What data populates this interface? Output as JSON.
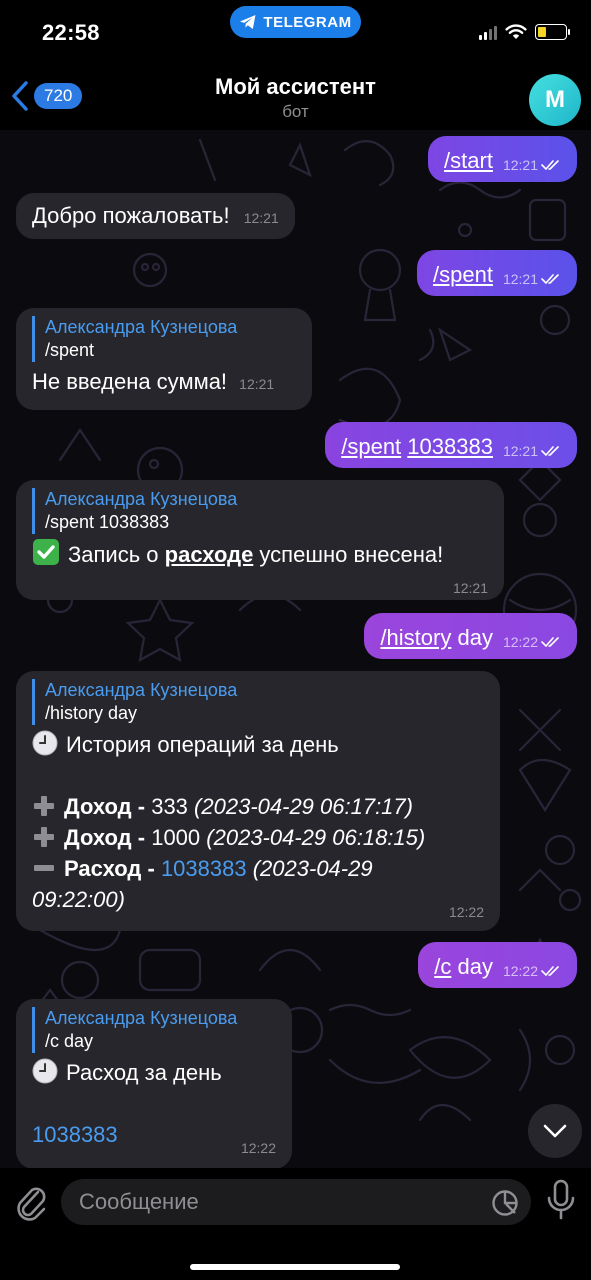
{
  "status_bar": {
    "time": "22:58",
    "app_pill": "TELEGRAM"
  },
  "nav": {
    "back_count": "720",
    "title": "Мой ассистент",
    "subtitle": "бот",
    "avatar_letter": "M"
  },
  "colors": {
    "outgoing_bubble": "#7e46e4",
    "incoming_bubble": "#26262c",
    "accent_blue": "#4a9cf0",
    "avatar": "#2fc9d4"
  },
  "messages": [
    {
      "dir": "out",
      "text": "/start",
      "time": "12:21",
      "read": true
    },
    {
      "dir": "in",
      "text": "Добро пожаловать!",
      "time": "12:21"
    },
    {
      "dir": "out",
      "text": "/spent",
      "time": "12:21",
      "read": true
    },
    {
      "dir": "in",
      "reply_author": "Александра Кузнецова",
      "reply_text": "/spent",
      "text": "Не введена сумма!",
      "time": "12:21"
    },
    {
      "dir": "out",
      "cmd": "/spent",
      "arg": "1038383",
      "time": "12:21",
      "read": true
    },
    {
      "dir": "in",
      "reply_author": "Александра Кузнецова",
      "reply_text": "/spent 1038383",
      "icon": "check-mark-icon",
      "pre": "Запись о ",
      "bold": "расходе",
      "post": " успешно внесена!",
      "time": "12:21"
    },
    {
      "dir": "out",
      "cmd": "/history",
      "arg": "day",
      "time": "12:22",
      "read": true
    },
    {
      "dir": "in",
      "reply_author": "Александра Кузнецова",
      "reply_text": "/history day",
      "icon": "clock-icon",
      "heading": "История операций за день",
      "rows": [
        {
          "icon": "plus-icon",
          "label": "Доход",
          "sep": " - ",
          "amount": "333",
          "date": "(2023-04-29 06:17:17)"
        },
        {
          "icon": "plus-icon",
          "label": "Доход",
          "sep": " - ",
          "amount": "1000",
          "date": "(2023-04-29 06:18:15)"
        },
        {
          "icon": "minus-icon",
          "label": "Расход",
          "sep": " - ",
          "amount": "1038383",
          "date_1": "(2023-04-29",
          "date_2": "09:22:00)"
        }
      ],
      "time": "12:22"
    },
    {
      "dir": "out",
      "cmd": "/c",
      "arg": "day",
      "time": "12:22",
      "read": true
    },
    {
      "dir": "in",
      "reply_author": "Александра Кузнецова",
      "reply_text": "/c day",
      "icon": "clock-icon",
      "heading": "Расход за день",
      "amount": "1038383",
      "time": "12:22"
    }
  ],
  "input": {
    "placeholder": "Сообщение"
  }
}
